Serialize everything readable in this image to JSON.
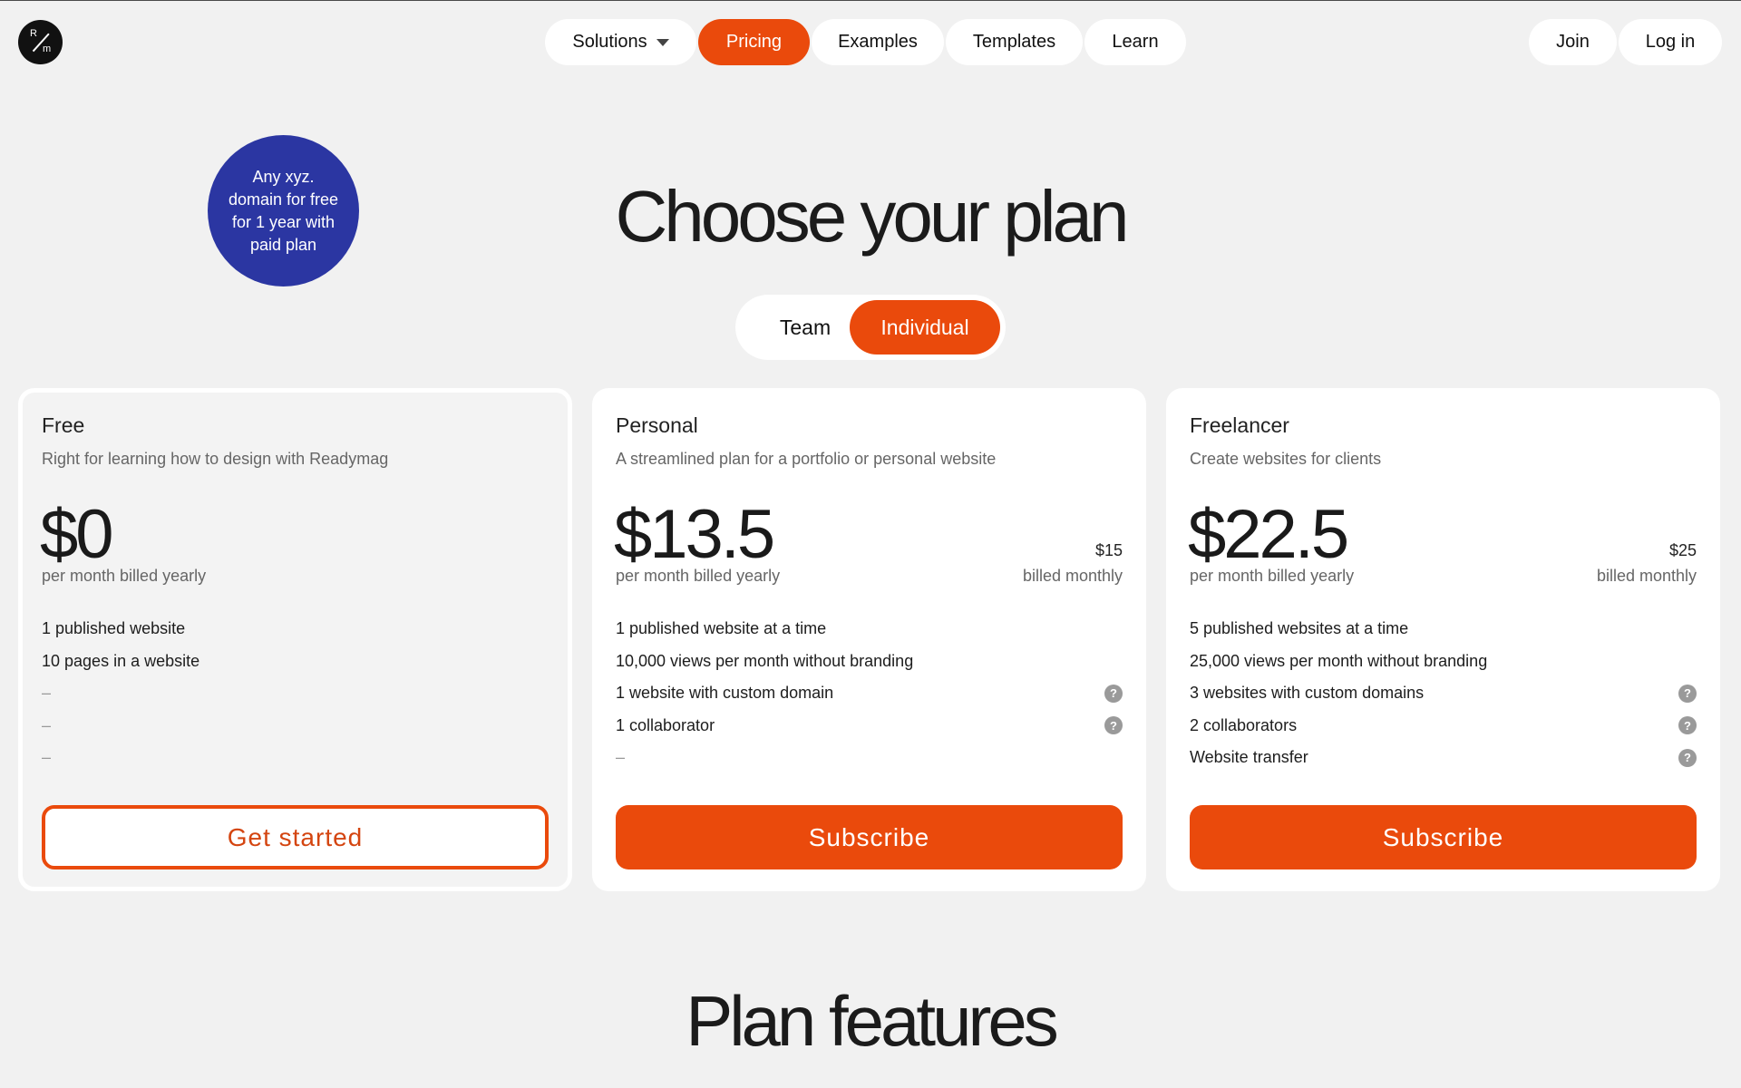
{
  "header": {
    "logo": {
      "top": "R",
      "bottom": "m"
    },
    "nav": [
      {
        "label": "Solutions",
        "has_dropdown": true
      },
      {
        "label": "Pricing",
        "active": true
      },
      {
        "label": "Examples"
      },
      {
        "label": "Templates"
      },
      {
        "label": "Learn"
      }
    ],
    "join_label": "Join",
    "login_label": "Log in"
  },
  "promo_badge": "Any xyz. domain for free for 1 year with paid plan",
  "title": "Choose your plan",
  "toggle": {
    "team": "Team",
    "individual": "Individual",
    "selected": "Individual"
  },
  "plans": [
    {
      "name": "Free",
      "description": "Right for learning how to design with Readymag",
      "price": "$0",
      "price_note": "per month billed yearly",
      "features": [
        "1 published website",
        "10 pages in a website",
        "–",
        "–",
        "–"
      ],
      "cta": "Get started"
    },
    {
      "name": "Personal",
      "description": "A streamlined plan for a portfolio or personal website",
      "price": "$13.5",
      "price_note": "per month billed yearly",
      "monthly_price": "$15",
      "monthly_note": "billed monthly",
      "features": [
        "1 published website at a time",
        "10,000 views per month without branding",
        "1 website with custom domain",
        "1 collaborator",
        "–"
      ],
      "cta": "Subscribe"
    },
    {
      "name": "Freelancer",
      "description": "Create websites for clients",
      "price": "$22.5",
      "price_note": "per month billed yearly",
      "monthly_price": "$25",
      "monthly_note": "billed monthly",
      "features": [
        "5 published websites at a time",
        "25,000 views per month without branding",
        "3 websites with custom domains",
        "2 collaborators",
        "Website transfer"
      ],
      "cta": "Subscribe"
    }
  ],
  "help_icon_glyph": "?",
  "features_heading": "Plan features",
  "colors": {
    "accent": "#ea4a0c",
    "badge": "#2b36a2",
    "background": "#f1f1f1"
  }
}
